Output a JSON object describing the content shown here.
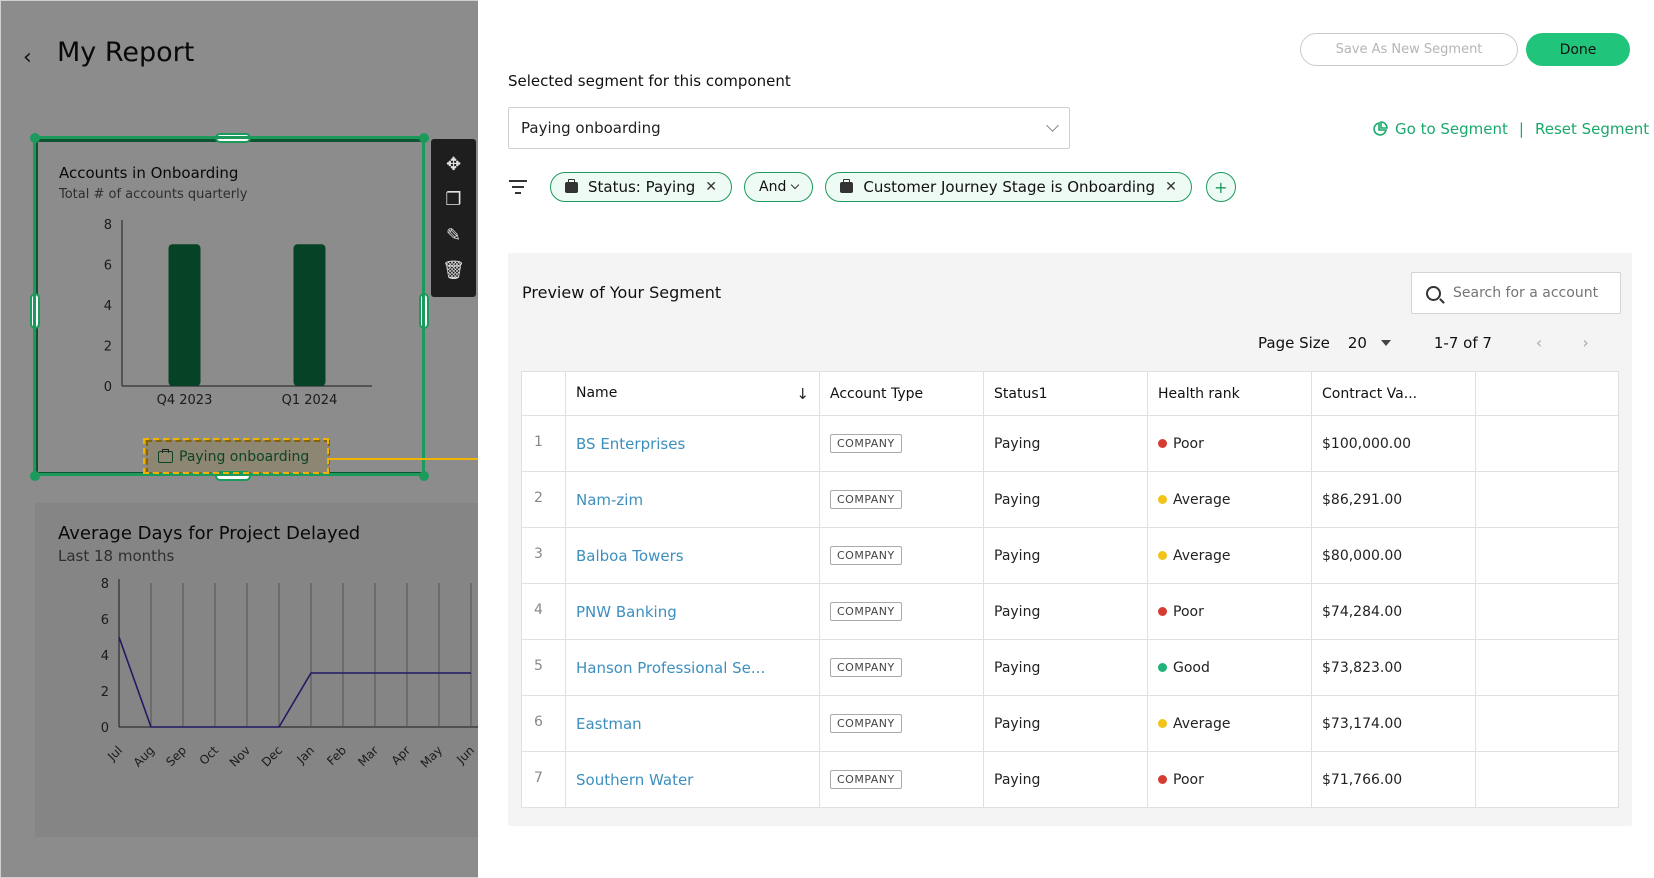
{
  "report": {
    "title": "My Report",
    "card1": {
      "title": "Accounts in Onboarding",
      "subtitle": "Total # of accounts quarterly",
      "segment_badge": "Paying onboarding"
    },
    "card2": {
      "title": "Average Days for Project Delayed",
      "subtitle": "Last 18 months"
    }
  },
  "chart_data": [
    {
      "type": "bar",
      "categories": [
        "Q4 2023",
        "Q1 2024"
      ],
      "values": [
        7,
        7
      ],
      "ylim": [
        0,
        8
      ],
      "yticks": [
        0,
        2,
        4,
        6,
        8
      ],
      "color": "#0b7a45"
    },
    {
      "type": "line",
      "x": [
        "Jul",
        "Aug",
        "Sep",
        "Oct",
        "Nov",
        "Dec",
        "Jan",
        "Feb",
        "Mar",
        "Apr",
        "May",
        "Jun"
      ],
      "values": [
        5,
        0,
        0,
        0,
        0,
        0,
        3,
        3,
        3,
        3,
        3,
        3
      ],
      "ylim": [
        0,
        8
      ],
      "yticks": [
        0,
        2,
        4,
        6,
        8
      ],
      "color": "#3b2fb5"
    }
  ],
  "panel": {
    "save_label": "Save As New Segment",
    "done_label": "Done",
    "selected_label": "Selected segment for this component",
    "selected_value": "Paying onboarding",
    "go_to_segment": "Go to Segment",
    "separator": "|",
    "reset_segment": "Reset Segment",
    "filters": [
      {
        "label": "Status: Paying"
      },
      {
        "label": "Customer Journey Stage is Onboarding"
      }
    ],
    "conjunction": "And"
  },
  "preview": {
    "title": "Preview of Your Segment",
    "search_placeholder": "Search for a account",
    "page_size_label": "Page Size",
    "page_size_value": "20",
    "range": "1-7 of 7",
    "columns": [
      "Name",
      "Account Type",
      "Status1",
      "Health rank",
      "Contract Va..."
    ],
    "rows": [
      {
        "idx": "1",
        "name": "BS Enterprises",
        "type": "COMPANY",
        "status": "Paying",
        "health": "Poor",
        "health_color": "#d63b2f",
        "contract": "$100,000.00"
      },
      {
        "idx": "2",
        "name": "Nam-zim",
        "type": "COMPANY",
        "status": "Paying",
        "health": "Average",
        "health_color": "#f2c318",
        "contract": "$86,291.00"
      },
      {
        "idx": "3",
        "name": "Balboa Towers",
        "type": "COMPANY",
        "status": "Paying",
        "health": "Average",
        "health_color": "#f2c318",
        "contract": "$80,000.00"
      },
      {
        "idx": "4",
        "name": "PNW Banking",
        "type": "COMPANY",
        "status": "Paying",
        "health": "Poor",
        "health_color": "#d63b2f",
        "contract": "$74,284.00"
      },
      {
        "idx": "5",
        "name": "Hanson Professional Se...",
        "type": "COMPANY",
        "status": "Paying",
        "health": "Good",
        "health_color": "#1fb37a",
        "contract": "$73,823.00"
      },
      {
        "idx": "6",
        "name": "Eastman",
        "type": "COMPANY",
        "status": "Paying",
        "health": "Average",
        "health_color": "#f2c318",
        "contract": "$73,174.00"
      },
      {
        "idx": "7",
        "name": "Southern Water",
        "type": "COMPANY",
        "status": "Paying",
        "health": "Poor",
        "health_color": "#d63b2f",
        "contract": "$71,766.00"
      }
    ]
  }
}
